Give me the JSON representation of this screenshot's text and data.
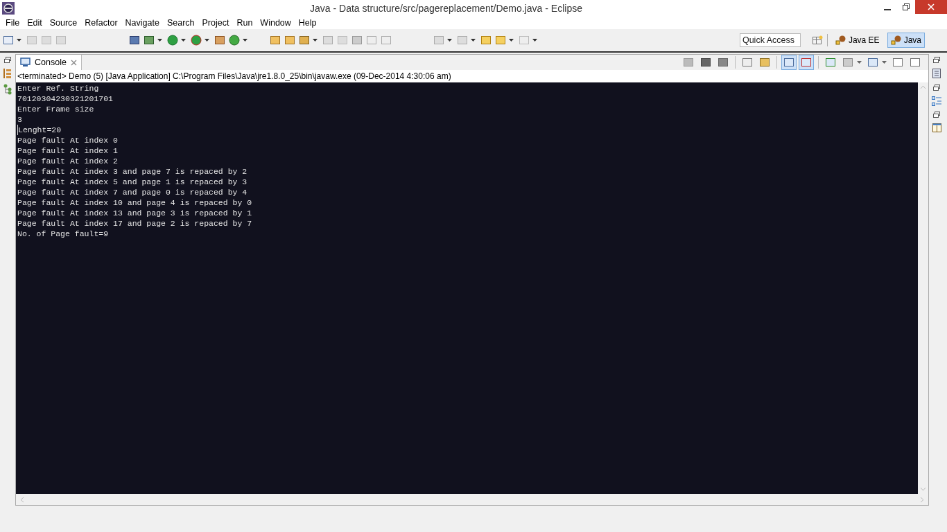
{
  "window": {
    "title": "Java - Data structure/src/pagereplacement/Demo.java - Eclipse"
  },
  "menu": [
    "File",
    "Edit",
    "Source",
    "Refactor",
    "Navigate",
    "Search",
    "Project",
    "Run",
    "Window",
    "Help"
  ],
  "quick_access": {
    "placeholder": "Quick Access"
  },
  "perspectives": [
    {
      "label": "Java EE",
      "selected": false
    },
    {
      "label": "Java",
      "selected": true
    }
  ],
  "view_tabs": [
    {
      "label": "Console",
      "selected": true
    }
  ],
  "console": {
    "status": "<terminated> Demo (5) [Java Application] C:\\Program Files\\Java\\jre1.8.0_25\\bin\\javaw.exe (09-Dec-2014 4:30:06 am)",
    "lines": [
      "Enter Ref. String",
      "70120304230321201701",
      "Enter Frame size",
      "3",
      "Lenght=20",
      "Page fault At index 0",
      "Page fault At index 1",
      "Page fault At index 2",
      "Page fault At index 3 and page 7 is repaced by 2",
      "Page fault At index 5 and page 1 is repaced by 3",
      "Page fault At index 7 and page 0 is repaced by 4",
      "Page fault At index 10 and page 4 is repaced by 0",
      "Page fault At index 13 and page 3 is repaced by 1",
      "Page fault At index 17 and page 2 is repaced by 7",
      "No. of Page fault=9"
    ]
  }
}
